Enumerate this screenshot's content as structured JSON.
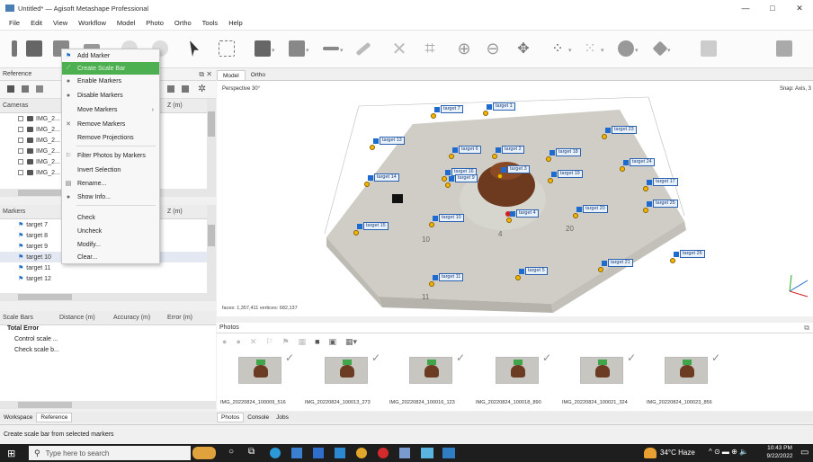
{
  "window": {
    "title": "Untitled* — Agisoft Metashape Professional",
    "buttons": [
      "—",
      "□",
      "✕"
    ]
  },
  "menu": [
    "File",
    "Edit",
    "View",
    "Workflow",
    "Model",
    "Photo",
    "Ortho",
    "Tools",
    "Help"
  ],
  "toolbar": {
    "icons": [
      "workspace-icon",
      "open-icon",
      "save-icon",
      "undo-icon",
      "redo-icon",
      "navigation-icon",
      "rectangle-selection-icon",
      "model-view-icon",
      "ruler-icon",
      "draw-icon",
      "delete-icon",
      "crop-icon",
      "zoom-in-icon",
      "zoom-out-icon",
      "move-icon",
      "points-icon",
      "grid-icon",
      "shading-icon",
      "cameras-icon",
      "texture-icon"
    ]
  },
  "reference": {
    "title": "Reference",
    "cameras_header": "Cameras",
    "cameras_zcol": "Z (m)",
    "cameras": [
      "IMG_2...",
      "IMG_2...",
      "IMG_2...",
      "IMG_2...",
      "IMG_2...",
      "IMG_2..."
    ],
    "markers_header": "Markers",
    "markers_zcol": "Z (m)",
    "markers": [
      "target 7",
      "target 8",
      "target 9",
      "target 10",
      "target 11",
      "target 12"
    ],
    "scalebars_headers": [
      "Scale Bars",
      "Distance (m)",
      "Accuracy (m)",
      "Error (m)"
    ],
    "scalebars_rows": [
      "Total Error",
      "Control scale ...",
      "Check scale b..."
    ]
  },
  "context_menu": {
    "items": [
      {
        "label": "Add Marker",
        "icon": "flag-icon"
      },
      {
        "label": "Create Scale Bar",
        "icon": "scale-bar-icon",
        "highlight": true
      },
      {
        "label": "Enable Markers",
        "icon": "enable-icon"
      },
      {
        "label": "Disable Markers",
        "icon": "disable-icon"
      },
      {
        "label": "Move Markers",
        "icon": "",
        "submenu": true
      },
      {
        "label": "Remove Markers",
        "icon": "remove-icon"
      },
      {
        "label": "Remove Projections",
        "icon": ""
      },
      {
        "label": "Filter Photos by Markers",
        "icon": "filter-icon"
      },
      {
        "label": "Invert Selection",
        "icon": ""
      },
      {
        "label": "Rename...",
        "icon": "rename-icon"
      },
      {
        "label": "Show Info...",
        "icon": "info-icon"
      },
      {
        "label": "Check",
        "icon": ""
      },
      {
        "label": "Uncheck",
        "icon": ""
      },
      {
        "label": "Modify...",
        "icon": ""
      },
      {
        "label": "Clear...",
        "icon": ""
      }
    ]
  },
  "viewport": {
    "tabs": [
      "Model",
      "Ortho"
    ],
    "perspective": "Perspective 30°",
    "snap": "Snap: Axis, 3",
    "stats": "faces: 1,357,411 vertices: 682,137",
    "targets": [
      "target 7",
      "target 1",
      "target 13",
      "target 23",
      "target 6",
      "target 2",
      "target 18",
      "target 24",
      "target 14",
      "target 16",
      "target 3",
      "target 19",
      "target 9",
      "target 17",
      "target 25",
      "target 15",
      "target 10",
      "target 4",
      "target 20",
      "target 26",
      "target 21",
      "target 5",
      "target 11"
    ],
    "ground_numbers": [
      "10",
      "4",
      "20",
      "11"
    ]
  },
  "photos": {
    "title": "Photos",
    "labels": [
      "IMG_20220824_100009_516",
      "IMG_20220824_100013_273",
      "IMG_20220824_100016_123",
      "IMG_20220824_100018_890",
      "IMG_20220824_100021_324",
      "IMG_20220824_100023_856"
    ]
  },
  "bottom_tabs_left": [
    "Workspace",
    "Reference"
  ],
  "bottom_tabs_right": [
    "Photos",
    "Console",
    "Jobs"
  ],
  "status": "Create scale bar from selected markers",
  "taskbar": {
    "search_placeholder": "Type here to search",
    "weather": "34°C Haze",
    "time": "10:43 PM",
    "date": "9/22/2022"
  },
  "colors": {
    "accent_green": "#4caf50",
    "marker_blue": "#1e6bd0",
    "marker_yellow": "#f6b400",
    "taskbar": "#1e1e1e"
  }
}
